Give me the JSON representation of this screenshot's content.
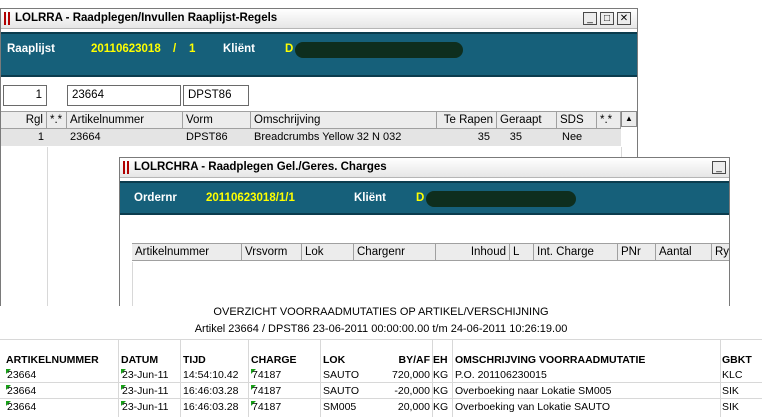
{
  "window1": {
    "title": "LOLRRA - Raadplegen/Invullen Raaplijst-Regels",
    "buttons": [
      "_",
      "□",
      "✕"
    ],
    "raaplijst_label": "Raaplijst",
    "raaplijst_number": "20110623018",
    "separator": "/",
    "raaplijst_seq": "1",
    "client_label": "Kliënt",
    "client_initial": "D",
    "filters": [
      "1",
      "23664",
      "DPST86"
    ],
    "columns": [
      "Rgl",
      "*.*",
      "Artikelnummer",
      "Vorm",
      "Omschrijving",
      "Te Rapen",
      "Geraapt",
      "SDS",
      "*.*"
    ],
    "rows": [
      [
        "1",
        "",
        "23664",
        "DPST86",
        "Breadcrumbs Yellow 32 N 032",
        "35",
        "35",
        "Nee",
        ""
      ]
    ]
  },
  "window2": {
    "title": "LOLRCHRA - Raadplegen Gel./Geres. Charges",
    "buttons": [
      "_"
    ],
    "order_label": "Ordernr",
    "order_value": "20110623018/1/1",
    "client_label": "Kliënt",
    "client_initial": "D",
    "columns": [
      "Artikelnummer",
      "Vrsvorm",
      "Lok",
      "Chargenr",
      "Inhoud",
      "L",
      "Int. Charge",
      "PNr",
      "Aantal",
      "Ry"
    ]
  },
  "report": {
    "title": "OVERZICHT VOORRAADMUTATIES OP ARTIKEL/VERSCHIJNING",
    "subtitle": "Artikel 23664 / DPST86 23-06-2011 00:00:00.00  t/m  24-06-2011 10:26:19.00",
    "columns": [
      "ARTIKELNUMMER",
      "DATUM",
      "TIJD",
      "CHARGE",
      "LOK",
      "BY/AF",
      "EH",
      "OMSCHRIJVING VOORRAADMUTATIE",
      "GBKT"
    ],
    "rows": [
      [
        "23664",
        "23-Jun-11",
        "14:54:10.42",
        "74187",
        "SAUTO",
        "720,000",
        "KG",
        "P.O. 201106230015",
        "KLC"
      ],
      [
        "23664",
        "23-Jun-11",
        "16:46:03.28",
        "74187",
        "SAUTO",
        "-20,000",
        "KG",
        "Overboeking naar Lokatie SM005",
        "SIK"
      ],
      [
        "23664",
        "23-Jun-11",
        "16:46:03.28",
        "74187",
        "SM005",
        "20,000",
        "KG",
        "Overboeking van Lokatie SAUTO",
        "SIK"
      ]
    ]
  },
  "colors": {
    "band": "#16607a",
    "band_label": "#ffffff",
    "band_value": "#ffff00",
    "title_mark": "#b00000",
    "cell_marker": "#18a018"
  }
}
